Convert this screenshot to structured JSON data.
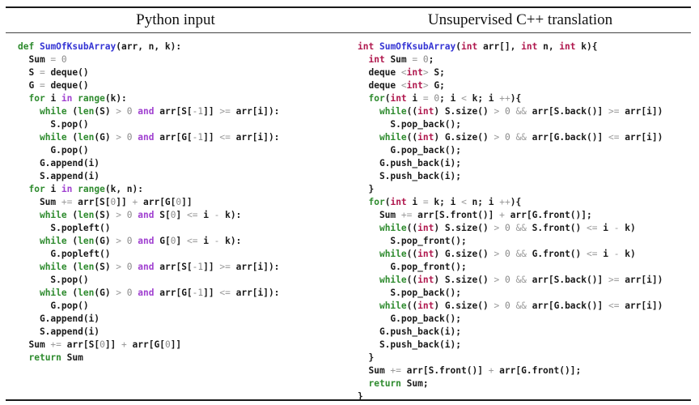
{
  "headers": {
    "left": "Python input",
    "right": "Unsupervised C++ translation"
  },
  "colors": {
    "keyword": "#2e8b2e",
    "function_name": "#3434d4",
    "type": "#b0184e",
    "logical_operator": "#a040d0",
    "operator": "#9a9a9a",
    "text": "#1a1a1a"
  },
  "python_code": [
    [
      {
        "t": "def",
        "c": "kw"
      },
      {
        "t": " "
      },
      {
        "t": "SumOfKsubArray",
        "c": "fn"
      },
      {
        "t": "(arr, n, k):"
      }
    ],
    [
      {
        "t": "  Sum "
      },
      {
        "t": "=",
        "c": "op"
      },
      {
        "t": " "
      },
      {
        "t": "0",
        "c": "num"
      }
    ],
    [
      {
        "t": "  S "
      },
      {
        "t": "=",
        "c": "op"
      },
      {
        "t": " deque()"
      }
    ],
    [
      {
        "t": "  G "
      },
      {
        "t": "=",
        "c": "op"
      },
      {
        "t": " deque()"
      }
    ],
    [
      {
        "t": "  "
      },
      {
        "t": "for",
        "c": "kw"
      },
      {
        "t": " i "
      },
      {
        "t": "in",
        "c": "lg"
      },
      {
        "t": " "
      },
      {
        "t": "range",
        "c": "kw"
      },
      {
        "t": "(k):"
      }
    ],
    [
      {
        "t": "    "
      },
      {
        "t": "while",
        "c": "kw"
      },
      {
        "t": " ("
      },
      {
        "t": "len",
        "c": "kw"
      },
      {
        "t": "(S) "
      },
      {
        "t": ">",
        "c": "op"
      },
      {
        "t": " "
      },
      {
        "t": "0",
        "c": "num"
      },
      {
        "t": " "
      },
      {
        "t": "and",
        "c": "lg"
      },
      {
        "t": " arr[S["
      },
      {
        "t": "-1",
        "c": "num"
      },
      {
        "t": "]] "
      },
      {
        "t": ">=",
        "c": "op"
      },
      {
        "t": " arr[i]):"
      }
    ],
    [
      {
        "t": "      S.pop()"
      }
    ],
    [
      {
        "t": "    "
      },
      {
        "t": "while",
        "c": "kw"
      },
      {
        "t": " ("
      },
      {
        "t": "len",
        "c": "kw"
      },
      {
        "t": "(G) "
      },
      {
        "t": ">",
        "c": "op"
      },
      {
        "t": " "
      },
      {
        "t": "0",
        "c": "num"
      },
      {
        "t": " "
      },
      {
        "t": "and",
        "c": "lg"
      },
      {
        "t": " arr[G["
      },
      {
        "t": "-1",
        "c": "num"
      },
      {
        "t": "]] "
      },
      {
        "t": "<=",
        "c": "op"
      },
      {
        "t": " arr[i]):"
      }
    ],
    [
      {
        "t": "      G.pop()"
      }
    ],
    [
      {
        "t": "    G.append(i)"
      }
    ],
    [
      {
        "t": "    S.append(i)"
      }
    ],
    [
      {
        "t": "  "
      },
      {
        "t": "for",
        "c": "kw"
      },
      {
        "t": " i "
      },
      {
        "t": "in",
        "c": "lg"
      },
      {
        "t": " "
      },
      {
        "t": "range",
        "c": "kw"
      },
      {
        "t": "(k, n):"
      }
    ],
    [
      {
        "t": "    Sum "
      },
      {
        "t": "+=",
        "c": "op"
      },
      {
        "t": " arr[S["
      },
      {
        "t": "0",
        "c": "num"
      },
      {
        "t": "]] "
      },
      {
        "t": "+",
        "c": "op"
      },
      {
        "t": " arr[G["
      },
      {
        "t": "0",
        "c": "num"
      },
      {
        "t": "]]"
      }
    ],
    [
      {
        "t": "    "
      },
      {
        "t": "while",
        "c": "kw"
      },
      {
        "t": " ("
      },
      {
        "t": "len",
        "c": "kw"
      },
      {
        "t": "(S) "
      },
      {
        "t": ">",
        "c": "op"
      },
      {
        "t": " "
      },
      {
        "t": "0",
        "c": "num"
      },
      {
        "t": " "
      },
      {
        "t": "and",
        "c": "lg"
      },
      {
        "t": " S["
      },
      {
        "t": "0",
        "c": "num"
      },
      {
        "t": "] "
      },
      {
        "t": "<=",
        "c": "op"
      },
      {
        "t": " i "
      },
      {
        "t": "-",
        "c": "op"
      },
      {
        "t": " k):"
      }
    ],
    [
      {
        "t": "      S.popleft()"
      }
    ],
    [
      {
        "t": "    "
      },
      {
        "t": "while",
        "c": "kw"
      },
      {
        "t": " ("
      },
      {
        "t": "len",
        "c": "kw"
      },
      {
        "t": "(G) "
      },
      {
        "t": ">",
        "c": "op"
      },
      {
        "t": " "
      },
      {
        "t": "0",
        "c": "num"
      },
      {
        "t": " "
      },
      {
        "t": "and",
        "c": "lg"
      },
      {
        "t": " G["
      },
      {
        "t": "0",
        "c": "num"
      },
      {
        "t": "] "
      },
      {
        "t": "<=",
        "c": "op"
      },
      {
        "t": " i "
      },
      {
        "t": "-",
        "c": "op"
      },
      {
        "t": " k):"
      }
    ],
    [
      {
        "t": "      G.popleft()"
      }
    ],
    [
      {
        "t": "    "
      },
      {
        "t": "while",
        "c": "kw"
      },
      {
        "t": " ("
      },
      {
        "t": "len",
        "c": "kw"
      },
      {
        "t": "(S) "
      },
      {
        "t": ">",
        "c": "op"
      },
      {
        "t": " "
      },
      {
        "t": "0",
        "c": "num"
      },
      {
        "t": " "
      },
      {
        "t": "and",
        "c": "lg"
      },
      {
        "t": " arr[S["
      },
      {
        "t": "-1",
        "c": "num"
      },
      {
        "t": "]] "
      },
      {
        "t": ">=",
        "c": "op"
      },
      {
        "t": " arr[i]):"
      }
    ],
    [
      {
        "t": "      S.pop()"
      }
    ],
    [
      {
        "t": "    "
      },
      {
        "t": "while",
        "c": "kw"
      },
      {
        "t": " ("
      },
      {
        "t": "len",
        "c": "kw"
      },
      {
        "t": "(G) "
      },
      {
        "t": ">",
        "c": "op"
      },
      {
        "t": " "
      },
      {
        "t": "0",
        "c": "num"
      },
      {
        "t": " "
      },
      {
        "t": "and",
        "c": "lg"
      },
      {
        "t": " arr[G["
      },
      {
        "t": "-1",
        "c": "num"
      },
      {
        "t": "]] "
      },
      {
        "t": "<=",
        "c": "op"
      },
      {
        "t": " arr[i]):"
      }
    ],
    [
      {
        "t": "      G.pop()"
      }
    ],
    [
      {
        "t": "    G.append(i)"
      }
    ],
    [
      {
        "t": "    S.append(i)"
      }
    ],
    [
      {
        "t": "  Sum "
      },
      {
        "t": "+=",
        "c": "op"
      },
      {
        "t": " arr[S["
      },
      {
        "t": "0",
        "c": "num"
      },
      {
        "t": "]] "
      },
      {
        "t": "+",
        "c": "op"
      },
      {
        "t": " arr[G["
      },
      {
        "t": "0",
        "c": "num"
      },
      {
        "t": "]]"
      }
    ],
    [
      {
        "t": "  "
      },
      {
        "t": "return",
        "c": "kw"
      },
      {
        "t": " Sum"
      }
    ]
  ],
  "cpp_code": [
    [
      {
        "t": "int",
        "c": "ty"
      },
      {
        "t": " "
      },
      {
        "t": "SumOfKsubArray",
        "c": "fn"
      },
      {
        "t": "("
      },
      {
        "t": "int",
        "c": "ty"
      },
      {
        "t": " arr[], "
      },
      {
        "t": "int",
        "c": "ty"
      },
      {
        "t": " n, "
      },
      {
        "t": "int",
        "c": "ty"
      },
      {
        "t": " k){"
      }
    ],
    [
      {
        "t": "  "
      },
      {
        "t": "int",
        "c": "ty"
      },
      {
        "t": " Sum "
      },
      {
        "t": "=",
        "c": "op"
      },
      {
        "t": " "
      },
      {
        "t": "0",
        "c": "num"
      },
      {
        "t": ";"
      }
    ],
    [
      {
        "t": "  deque "
      },
      {
        "t": "<",
        "c": "op"
      },
      {
        "t": "int",
        "c": "ty"
      },
      {
        "t": ">",
        "c": "op"
      },
      {
        "t": " S;"
      }
    ],
    [
      {
        "t": "  deque "
      },
      {
        "t": "<",
        "c": "op"
      },
      {
        "t": "int",
        "c": "ty"
      },
      {
        "t": ">",
        "c": "op"
      },
      {
        "t": " G;"
      }
    ],
    [
      {
        "t": "  "
      },
      {
        "t": "for",
        "c": "kw"
      },
      {
        "t": "("
      },
      {
        "t": "int",
        "c": "ty"
      },
      {
        "t": " i "
      },
      {
        "t": "=",
        "c": "op"
      },
      {
        "t": " "
      },
      {
        "t": "0",
        "c": "num"
      },
      {
        "t": "; i "
      },
      {
        "t": "<",
        "c": "op"
      },
      {
        "t": " k; i "
      },
      {
        "t": "++",
        "c": "op"
      },
      {
        "t": "){"
      }
    ],
    [
      {
        "t": "    "
      },
      {
        "t": "while",
        "c": "kw"
      },
      {
        "t": "(("
      },
      {
        "t": "int",
        "c": "ty"
      },
      {
        "t": ") S.size() "
      },
      {
        "t": ">",
        "c": "op"
      },
      {
        "t": " "
      },
      {
        "t": "0",
        "c": "num"
      },
      {
        "t": " "
      },
      {
        "t": "&&",
        "c": "op"
      },
      {
        "t": " arr[S.back()] "
      },
      {
        "t": ">=",
        "c": "op"
      },
      {
        "t": " arr[i])"
      }
    ],
    [
      {
        "t": "      S.pop_back();"
      }
    ],
    [
      {
        "t": "    "
      },
      {
        "t": "while",
        "c": "kw"
      },
      {
        "t": "(("
      },
      {
        "t": "int",
        "c": "ty"
      },
      {
        "t": ") G.size() "
      },
      {
        "t": ">",
        "c": "op"
      },
      {
        "t": " "
      },
      {
        "t": "0",
        "c": "num"
      },
      {
        "t": " "
      },
      {
        "t": "&&",
        "c": "op"
      },
      {
        "t": " arr[G.back()] "
      },
      {
        "t": "<=",
        "c": "op"
      },
      {
        "t": " arr[i])"
      }
    ],
    [
      {
        "t": "      G.pop_back();"
      }
    ],
    [
      {
        "t": "    G.push_back(i);"
      }
    ],
    [
      {
        "t": "    S.push_back(i);"
      }
    ],
    [
      {
        "t": "  }"
      }
    ],
    [
      {
        "t": "  "
      },
      {
        "t": "for",
        "c": "kw"
      },
      {
        "t": "("
      },
      {
        "t": "int",
        "c": "ty"
      },
      {
        "t": " i "
      },
      {
        "t": "=",
        "c": "op"
      },
      {
        "t": " k; i "
      },
      {
        "t": "<",
        "c": "op"
      },
      {
        "t": " n; i "
      },
      {
        "t": "++",
        "c": "op"
      },
      {
        "t": "){"
      }
    ],
    [
      {
        "t": "    Sum "
      },
      {
        "t": "+=",
        "c": "op"
      },
      {
        "t": " arr[S.front()] "
      },
      {
        "t": "+",
        "c": "op"
      },
      {
        "t": " arr[G.front()];"
      }
    ],
    [
      {
        "t": "    "
      },
      {
        "t": "while",
        "c": "kw"
      },
      {
        "t": "(("
      },
      {
        "t": "int",
        "c": "ty"
      },
      {
        "t": ") S.size() "
      },
      {
        "t": ">",
        "c": "op"
      },
      {
        "t": " "
      },
      {
        "t": "0",
        "c": "num"
      },
      {
        "t": " "
      },
      {
        "t": "&&",
        "c": "op"
      },
      {
        "t": " S.front() "
      },
      {
        "t": "<=",
        "c": "op"
      },
      {
        "t": " i "
      },
      {
        "t": "-",
        "c": "op"
      },
      {
        "t": " k)"
      }
    ],
    [
      {
        "t": "      S.pop_front();"
      }
    ],
    [
      {
        "t": "    "
      },
      {
        "t": "while",
        "c": "kw"
      },
      {
        "t": "(("
      },
      {
        "t": "int",
        "c": "ty"
      },
      {
        "t": ") G.size() "
      },
      {
        "t": ">",
        "c": "op"
      },
      {
        "t": " "
      },
      {
        "t": "0",
        "c": "num"
      },
      {
        "t": " "
      },
      {
        "t": "&&",
        "c": "op"
      },
      {
        "t": " G.front() "
      },
      {
        "t": "<=",
        "c": "op"
      },
      {
        "t": " i "
      },
      {
        "t": "-",
        "c": "op"
      },
      {
        "t": " k)"
      }
    ],
    [
      {
        "t": "      G.pop_front();"
      }
    ],
    [
      {
        "t": "    "
      },
      {
        "t": "while",
        "c": "kw"
      },
      {
        "t": "(("
      },
      {
        "t": "int",
        "c": "ty"
      },
      {
        "t": ") S.size() "
      },
      {
        "t": ">",
        "c": "op"
      },
      {
        "t": " "
      },
      {
        "t": "0",
        "c": "num"
      },
      {
        "t": " "
      },
      {
        "t": "&&",
        "c": "op"
      },
      {
        "t": " arr[S.back()] "
      },
      {
        "t": ">=",
        "c": "op"
      },
      {
        "t": " arr[i])"
      }
    ],
    [
      {
        "t": "      S.pop_back();"
      }
    ],
    [
      {
        "t": "    "
      },
      {
        "t": "while",
        "c": "kw"
      },
      {
        "t": "(("
      },
      {
        "t": "int",
        "c": "ty"
      },
      {
        "t": ") G.size() "
      },
      {
        "t": ">",
        "c": "op"
      },
      {
        "t": " "
      },
      {
        "t": "0",
        "c": "num"
      },
      {
        "t": " "
      },
      {
        "t": "&&",
        "c": "op"
      },
      {
        "t": " arr[G.back()] "
      },
      {
        "t": "<=",
        "c": "op"
      },
      {
        "t": " arr[i])"
      }
    ],
    [
      {
        "t": "      G.pop_back();"
      }
    ],
    [
      {
        "t": "    G.push_back(i);"
      }
    ],
    [
      {
        "t": "    S.push_back(i);"
      }
    ],
    [
      {
        "t": "  }"
      }
    ],
    [
      {
        "t": "  Sum "
      },
      {
        "t": "+=",
        "c": "op"
      },
      {
        "t": " arr[S.front()] "
      },
      {
        "t": "+",
        "c": "op"
      },
      {
        "t": " arr[G.front()];"
      }
    ],
    [
      {
        "t": "  "
      },
      {
        "t": "return",
        "c": "kw"
      },
      {
        "t": " Sum;"
      }
    ],
    [
      {
        "t": "}"
      }
    ]
  ]
}
